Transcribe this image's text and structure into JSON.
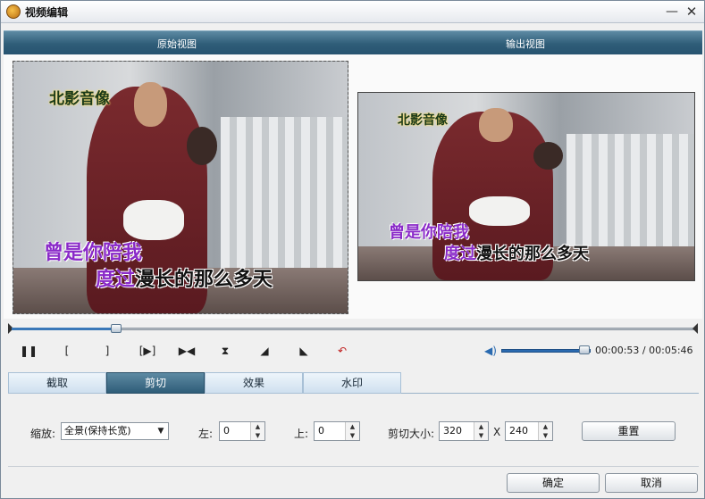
{
  "window": {
    "title": "视频编辑",
    "minimize_glyph": "—",
    "close_glyph": "✕"
  },
  "views": {
    "original_label": "原始视图",
    "output_label": "输出视图"
  },
  "video_overlay": {
    "channel_logo": "北影音像",
    "lyric_line1_sung": "曾是你陪我",
    "lyric_line1_rest": "",
    "lyric_line2_sung": "度过",
    "lyric_line2_rest": "漫长的那么多天"
  },
  "playback": {
    "position_fraction": 0.153,
    "current_time": "00:00:53",
    "total_time": "00:05:46",
    "time_separator": "/",
    "volume_fraction": 0.93
  },
  "controls": [
    {
      "name": "pause-button",
      "glyph": "❚❚",
      "icon": "pause-icon"
    },
    {
      "name": "mark-in-button",
      "glyph": "[",
      "icon": "mark-in-icon"
    },
    {
      "name": "mark-out-button",
      "glyph": "]",
      "icon": "mark-out-icon"
    },
    {
      "name": "play-selection-button",
      "glyph": "[▶]",
      "icon": "play-selection-icon"
    },
    {
      "name": "next-frame-button",
      "glyph": "▶◀",
      "icon": "frame-step-icon"
    },
    {
      "name": "flip-vertical-button",
      "glyph": "⧗",
      "icon": "flip-vertical-icon"
    },
    {
      "name": "rotate-right-button",
      "glyph": "◢",
      "icon": "rotate-right-icon"
    },
    {
      "name": "rotate-left-button",
      "glyph": "◣",
      "icon": "rotate-left-icon"
    },
    {
      "name": "undo-button",
      "glyph": "↶",
      "icon": "undo-icon"
    }
  ],
  "tabs": [
    {
      "label": "截取",
      "active": false
    },
    {
      "label": "剪切",
      "active": true
    },
    {
      "label": "效果",
      "active": false
    },
    {
      "label": "水印",
      "active": false
    }
  ],
  "crop_panel": {
    "zoom_label": "缩放:",
    "zoom_value": "全景(保持长宽)",
    "left_label": "左:",
    "left_value": "0",
    "top_label": "上:",
    "top_value": "0",
    "size_label": "剪切大小:",
    "width_value": "320",
    "size_separator": "X",
    "height_value": "240",
    "reset_label": "重置"
  },
  "footer": {
    "ok_label": "确定",
    "cancel_label": "取消"
  }
}
